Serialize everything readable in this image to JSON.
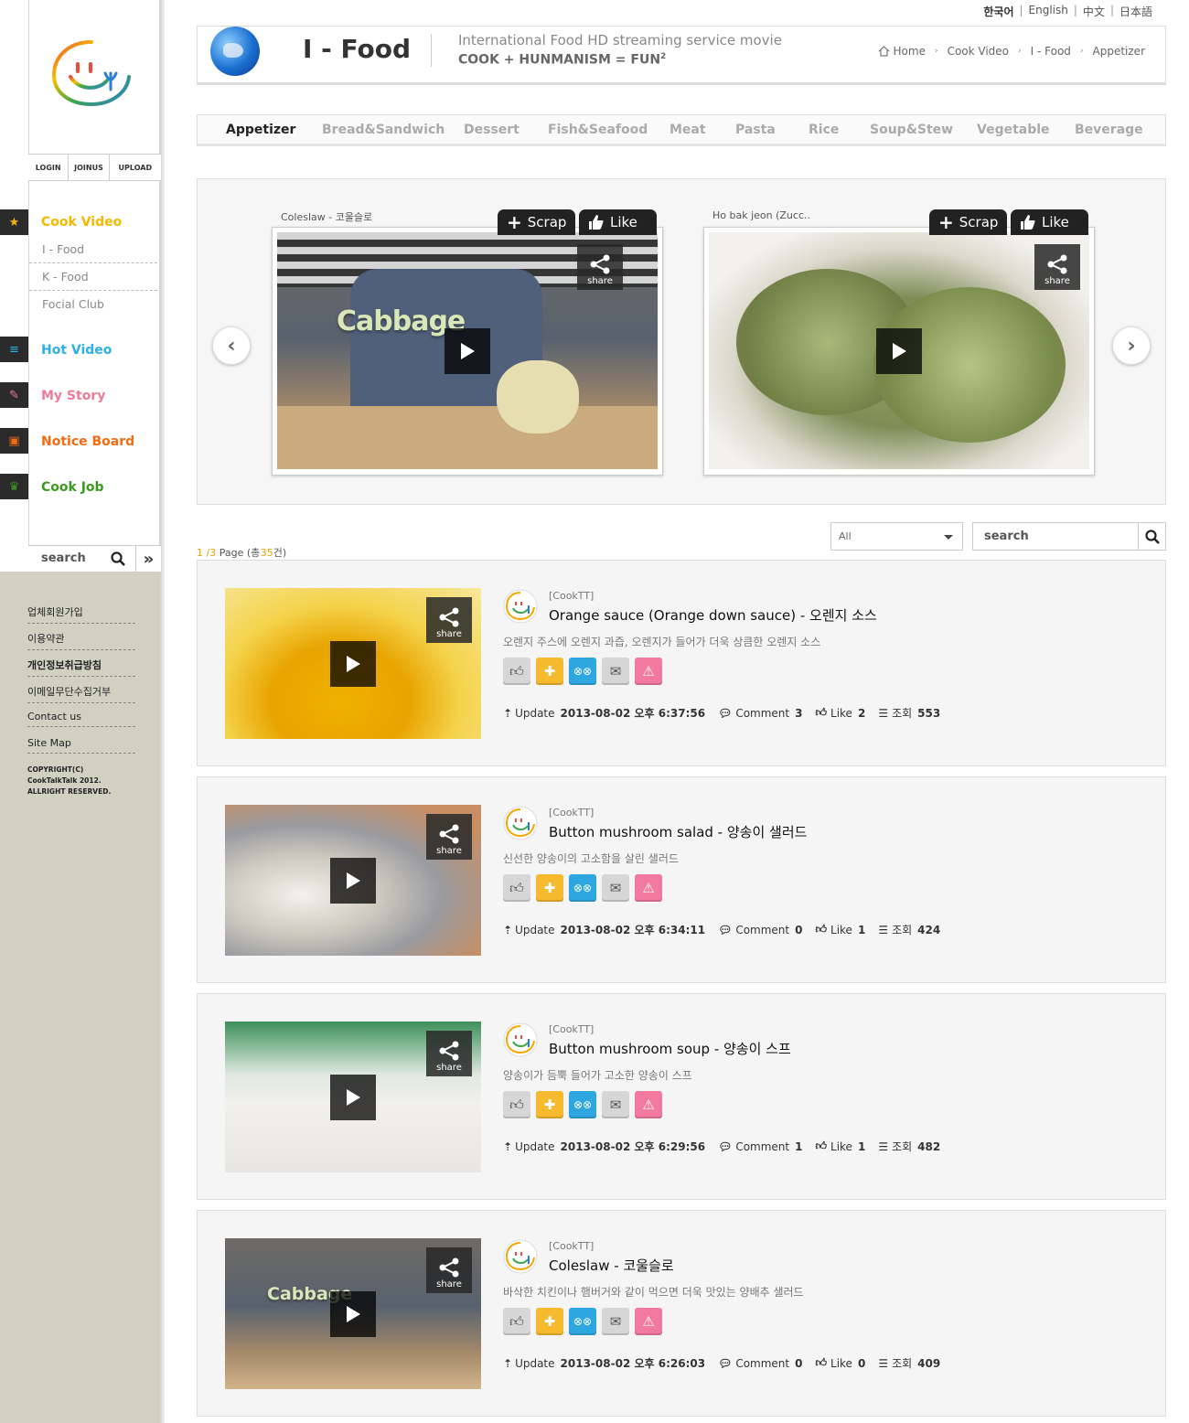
{
  "lang": [
    "한국어",
    "English",
    "中文",
    "日本語"
  ],
  "sidebar": {
    "auth": [
      "LOGIN",
      "JOINUS",
      "UPLOAD"
    ],
    "nav": [
      {
        "label": "Cook Video",
        "color": "#f5b800",
        "icon": "star-icon"
      },
      {
        "label": "Hot Video",
        "color": "#2db0e8",
        "icon": "list-icon"
      },
      {
        "label": "My Story",
        "color": "#ef7b9b",
        "icon": "pencil-icon"
      },
      {
        "label": "Notice Board",
        "color": "#f26a12",
        "icon": "board-icon"
      },
      {
        "label": "Cook Job",
        "color": "#3a9b1f",
        "icon": "chef-icon"
      }
    ],
    "sub": [
      "I - Food",
      "K - Food",
      "Focial Club"
    ],
    "search": "search",
    "footer": [
      "업체회원가입",
      "이용약관",
      "개인정보취급방침",
      "이메일무단수집거부",
      "Contact us",
      "Site Map"
    ],
    "copyright": "COPYRIGHT(C)\nCookTalkTalk 2012.\nALLRIGHT RESERVED."
  },
  "header": {
    "title": "I - Food",
    "tagline": "International Food HD streaming service movie",
    "slogan": "COOK + HUNMANISM = FUN",
    "slogan_sup": "2",
    "breadcrumb": [
      "Home",
      "Cook Video",
      "I - Food",
      "Appetizer"
    ]
  },
  "categories": [
    "Appetizer",
    "Bread&Sandwich",
    "Dessert",
    "Fish&Seafood",
    "Meat",
    "Pasta",
    "Rice",
    "Soup&Stew",
    "Vegetable",
    "Beverage"
  ],
  "active_category": "Appetizer",
  "carousel": {
    "scrap": "Scrap",
    "like": "Like",
    "share": "share",
    "slides": [
      {
        "caption": "Coleslaw - 코울슬로",
        "overlay": "Cabbage"
      },
      {
        "caption": "Ho bak jeon (Zucc..",
        "overlay": ""
      }
    ]
  },
  "list": {
    "page_current": "1",
    "page_total": "/3",
    "page_word": "Page (총",
    "count": "35",
    "count_suffix": "건)",
    "filter": "All",
    "search": "search",
    "labels": {
      "update": "Update",
      "comment": "Comment",
      "like": "Like",
      "views": "조회",
      "share": "share"
    },
    "items": [
      {
        "author": "[CookTT]",
        "title": "Orange sauce (Orange down sauce) - 오렌지 소스",
        "desc": "오렌지 주스에 오렌지 과즙, 오렌지가 들어가 더욱 상큼한 오렌지 소스",
        "update": "2013-08-02 오후 6:37:56",
        "comment": "3",
        "like": "2",
        "views": "553",
        "overlay": ""
      },
      {
        "author": "[CookTT]",
        "title": "Button mushroom salad - 양송이 샐러드",
        "desc": "신선한 양송이의 고소함을 살린 샐러드",
        "update": "2013-08-02 오후 6:34:11",
        "comment": "0",
        "like": "1",
        "views": "424",
        "overlay": ""
      },
      {
        "author": "[CookTT]",
        "title": "Button mushroom soup - 양송이 스프",
        "desc": "양송이가 듬뿍 들어가 고소한 양송이 스프",
        "update": "2013-08-02 오후 6:29:56",
        "comment": "1",
        "like": "1",
        "views": "482",
        "overlay": ""
      },
      {
        "author": "[CookTT]",
        "title": "Coleslaw - 코울슬로",
        "desc": "바삭한 치킨이나 햄버거와 같이 먹으면 더욱 맛있는 양배추 샐러드",
        "update": "2013-08-02 오후 6:26:03",
        "comment": "0",
        "like": "0",
        "views": "409",
        "overlay": "Cabbage"
      }
    ]
  }
}
